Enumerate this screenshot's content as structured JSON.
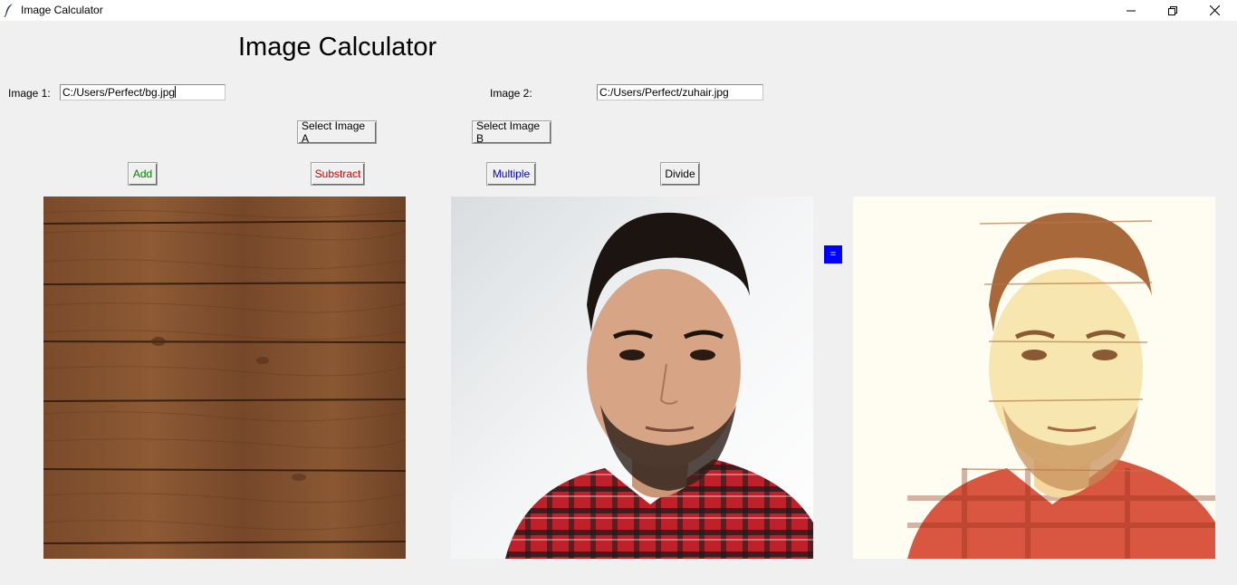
{
  "window": {
    "title": "Image Calculator"
  },
  "header": {
    "title": "Image Calculator"
  },
  "inputs": {
    "image1_label": "Image 1:",
    "image1_value": "C:/Users/Perfect/bg.jpg",
    "image2_label": "Image 2:",
    "image2_value": "C:/Users/Perfect/zuhair.jpg"
  },
  "buttons": {
    "select_a": "Select Image A",
    "select_b": "Select Image B",
    "add": "Add",
    "subtract": "Substract",
    "multiple": "Multiple",
    "divide": "Divide"
  },
  "operators": {
    "plus": "+",
    "equals": "="
  },
  "colors": {
    "add": "#008000",
    "subtract": "#cc0000",
    "multiple": "#0000cc",
    "divide": "#000000",
    "operator_bg": "#0000ff"
  },
  "icons": {
    "app": "feather-icon",
    "minimize": "minimize-icon",
    "maximize": "restore-icon",
    "close": "close-icon"
  }
}
